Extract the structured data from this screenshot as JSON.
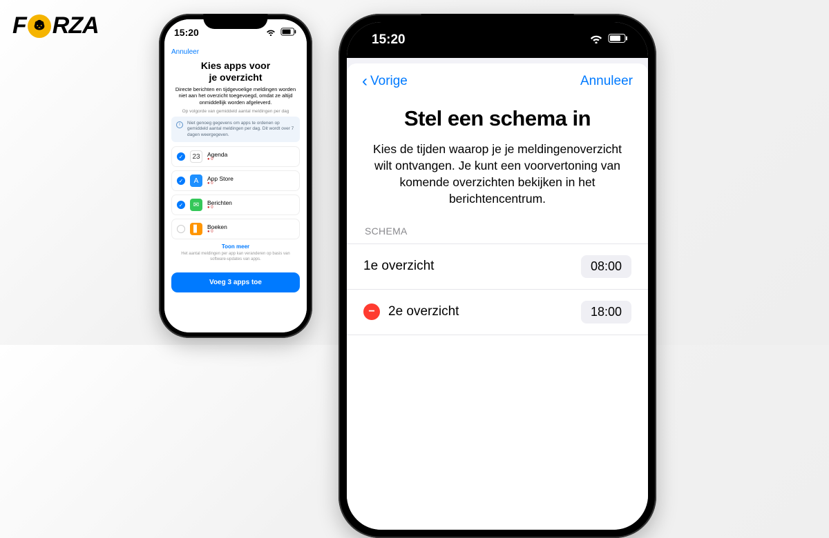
{
  "logo": {
    "text_left": "F",
    "text_right": "RZA"
  },
  "status_time": "15:20",
  "small": {
    "cancel": "Annuleer",
    "title_line1": "Kies apps voor",
    "title_line2": "je overzicht",
    "subtitle": "Directe berichten en tijdgevoelige meldingen worden niet aan het overzicht toegevoegd, omdat ze altijd onmiddellijk worden afgeleverd.",
    "sort_hint": "Op volgorde van gemiddeld aantal meldingen per dag",
    "info": "Niet genoeg gegevens om apps te ordenen op gemiddeld aantal meldingen per dag. Dit wordt over 7 dagen weergegeven.",
    "apps": [
      {
        "name": "Agenda",
        "meta": "0",
        "checked": true,
        "bg": "#ffffff",
        "glyph": "23",
        "glyphColor": "#e44"
      },
      {
        "name": "App Store",
        "meta": "0",
        "checked": true,
        "bg": "#1e90ff",
        "glyph": "A"
      },
      {
        "name": "Berichten",
        "meta": "0",
        "checked": true,
        "bg": "#34c759",
        "glyph": "✉"
      },
      {
        "name": "Boeken",
        "meta": "0",
        "checked": false,
        "bg": "#ff9500",
        "glyph": "▋"
      }
    ],
    "show_more": "Toon meer",
    "footnote": "Het aantal meldingen per app kan veranderen op basis van software-updates van apps.",
    "cta": "Voeg 3 apps toe"
  },
  "big": {
    "back": "Vorige",
    "cancel": "Annuleer",
    "title": "Stel een schema in",
    "subtitle": "Kies de tijden waarop je je meldingenoverzicht wilt ontvangen. Je kunt een voorvertoning van komende overzichten bekijken in het berichtencentrum.",
    "section_label": "SCHEMA",
    "rows": [
      {
        "label": "1e overzicht",
        "time": "08:00",
        "removable": false
      },
      {
        "label": "2e overzicht",
        "time": "18:00",
        "removable": true
      }
    ]
  }
}
